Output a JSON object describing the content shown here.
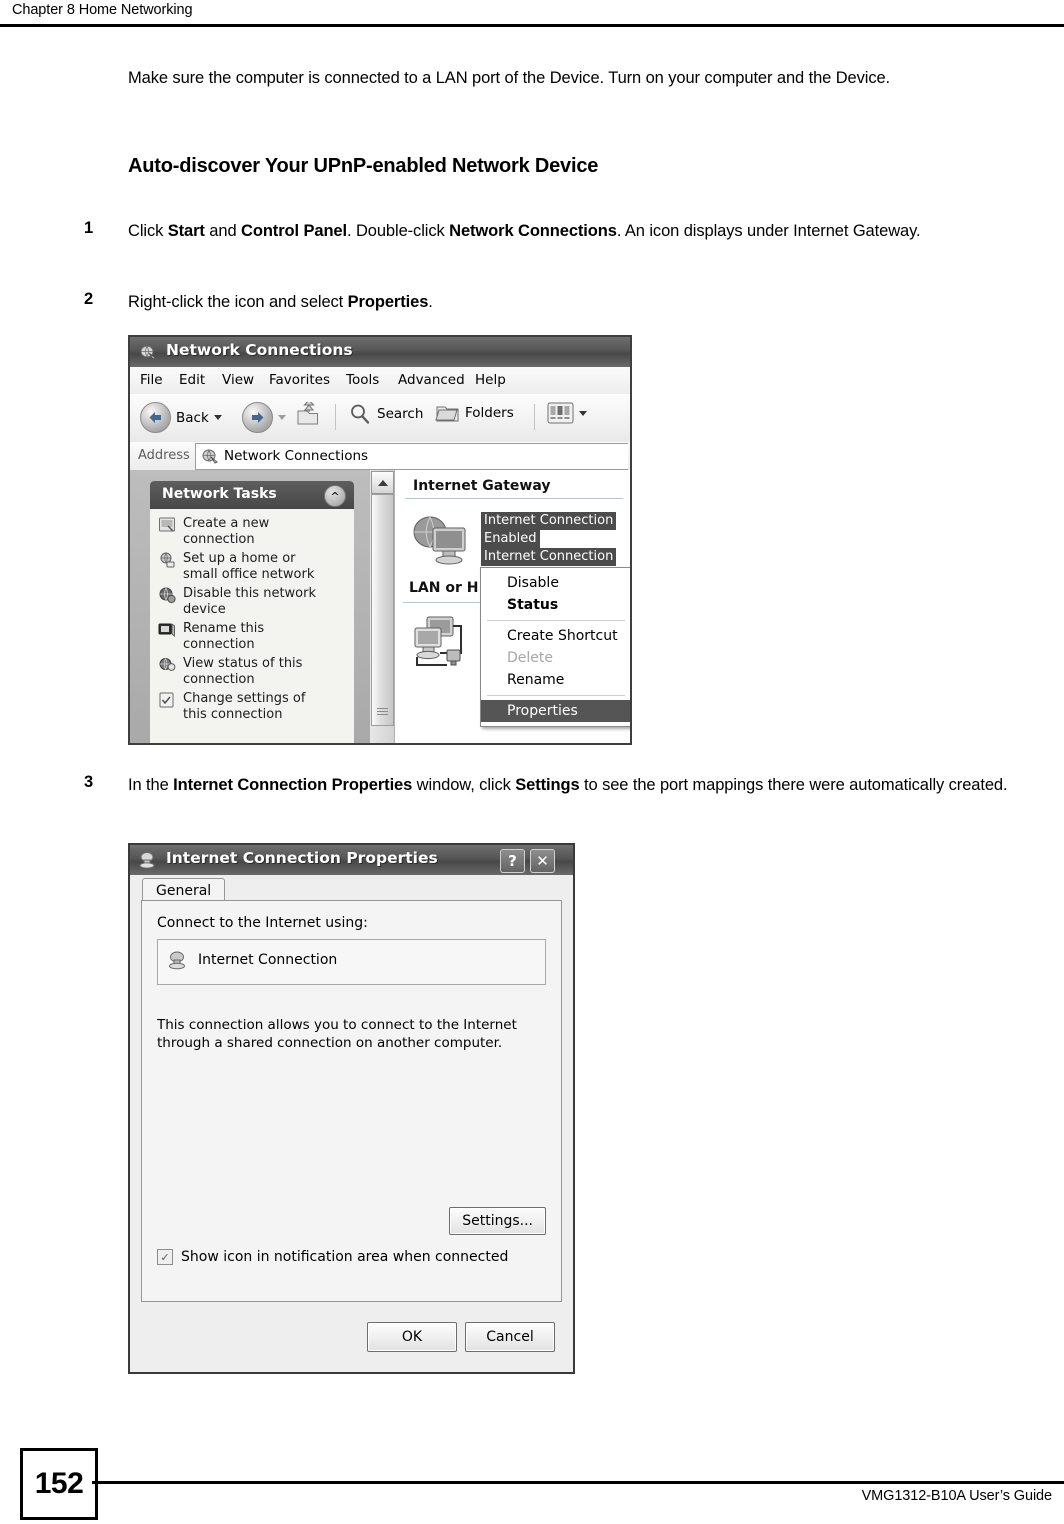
{
  "header": {
    "chapter": "Chapter 8 Home Networking"
  },
  "intro": {
    "paragraph": "Make sure the computer is connected to a LAN port of the Device. Turn on your computer and the Device."
  },
  "heading": "Auto-discover Your UPnP-enabled Network Device",
  "steps": [
    {
      "number": "1",
      "text_1": "Click ",
      "bold_1": "Start",
      "text_2": " and ",
      "bold_2": "Control Panel",
      "text_3": ". Double-click ",
      "bold_3": "Network Connections",
      "text_4": ". An icon displays under Internet Gateway."
    },
    {
      "number": "2",
      "text_1": "Right-click the icon and select ",
      "bold_1": "Properties",
      "text_2": "."
    },
    {
      "number": "3",
      "text_1": "In the ",
      "bold_1": "Internet Connection Properties",
      "text_2": " window, click ",
      "bold_2": "Settings",
      "text_3": " to see the port mappings there were automatically created."
    }
  ],
  "network_connections_window": {
    "title": "Network Connections",
    "title_icon": "network-connections-icon",
    "menu": [
      "File",
      "Edit",
      "View",
      "Favorites",
      "Tools",
      "Advanced",
      "Help"
    ],
    "toolbar": {
      "back_label": "Back",
      "back_icon": "back-arrow-icon",
      "back_dropdown_icon": "chevron-down-icon",
      "forward_icon": "forward-arrow-icon",
      "forward_dropdown_icon": "chevron-down-icon",
      "up_icon": "up-folder-icon",
      "search_label": "Search",
      "search_icon": "magnifier-icon",
      "folders_label": "Folders",
      "folders_icon": "folder-icon",
      "views_icon": "views-icon",
      "views_dropdown_icon": "chevron-down-icon"
    },
    "address": {
      "label": "Address",
      "value": "Network Connections",
      "icon": "network-connections-icon"
    },
    "tasks_panel": {
      "title": "Network Tasks",
      "collapse_icon": "chevron-up-icon",
      "items": [
        {
          "label": "Create a new connection",
          "icon": "new-connection-icon"
        },
        {
          "label": "Set up a home or small office network",
          "icon": "home-network-icon"
        },
        {
          "label": "Disable this network device",
          "icon": "disable-device-icon"
        },
        {
          "label": "Rename this connection",
          "icon": "rename-icon"
        },
        {
          "label": "View status of this connection",
          "icon": "view-status-icon"
        },
        {
          "label": "Change settings of this connection",
          "icon": "settings-icon"
        }
      ]
    },
    "groups": [
      {
        "title": "Internet Gateway"
      },
      {
        "title": "LAN or H"
      }
    ],
    "connection": {
      "name": "Internet Connection",
      "status": "Enabled",
      "device": "Internet Connection",
      "icon": "internet-gateway-icon"
    },
    "lan_icon": "lan-connection-icon",
    "context_menu": [
      {
        "label": "Disable",
        "state": "normal"
      },
      {
        "label": "Status",
        "state": "bold"
      },
      {
        "label": "---",
        "state": "separator"
      },
      {
        "label": "Create Shortcut",
        "state": "normal"
      },
      {
        "label": "Delete",
        "state": "disabled"
      },
      {
        "label": "Rename",
        "state": "normal"
      },
      {
        "label": "---",
        "state": "separator"
      },
      {
        "label": "Properties",
        "state": "selected"
      }
    ]
  },
  "internet_connection_properties_dialog": {
    "title": "Internet Connection Properties",
    "title_icon": "internet-connection-icon",
    "help_button": "?",
    "close_button": "✕",
    "tab": "General",
    "connect_label": "Connect to the Internet using:",
    "connection_item": "Internet Connection",
    "connection_item_icon": "internet-connection-icon",
    "description": "This connection allows you to connect to the Internet through a shared connection on another computer.",
    "settings_button": "Settings...",
    "checkbox_label": "Show icon in notification area when connected",
    "checkbox_checked": true,
    "checkbox_glyph": "✓",
    "ok_button": "OK",
    "cancel_button": "Cancel"
  },
  "footer": {
    "page_number": "152",
    "guide": "VMG1312-B10A User’s Guide"
  }
}
